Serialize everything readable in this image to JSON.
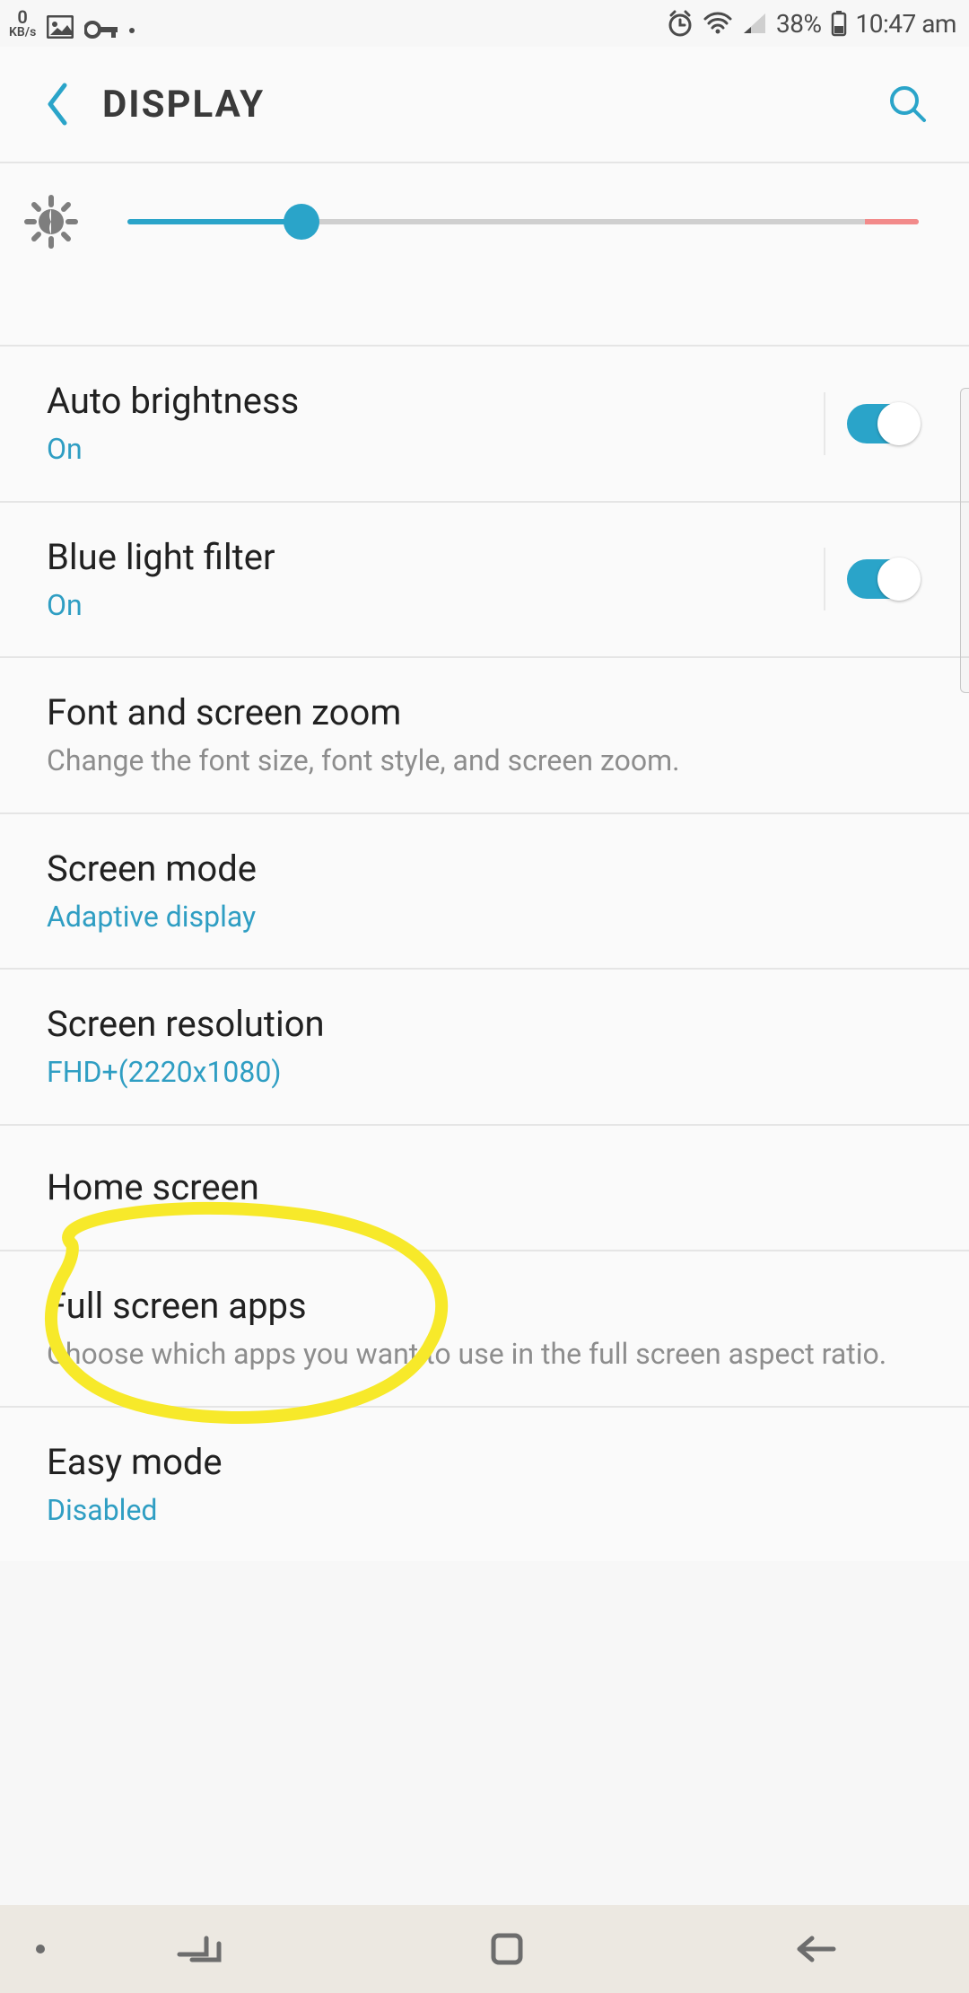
{
  "status": {
    "kbs_value": "0",
    "kbs_unit": "KB/s",
    "battery_pct": "38%",
    "time": "10:47 am"
  },
  "header": {
    "title": "DISPLAY"
  },
  "brightness": {
    "percent": 22
  },
  "rows": {
    "auto_brightness": {
      "title": "Auto brightness",
      "status": "On"
    },
    "blue_light": {
      "title": "Blue light filter",
      "status": "On"
    },
    "font_zoom": {
      "title": "Font and screen zoom",
      "sub": "Change the font size, font style, and screen zoom."
    },
    "screen_mode": {
      "title": "Screen mode",
      "sub": "Adaptive display"
    },
    "screen_res": {
      "title": "Screen resolution",
      "sub": "FHD+(2220x1080)"
    },
    "home_screen": {
      "title": "Home screen"
    },
    "full_screen": {
      "title": "Full screen apps",
      "sub": "Choose which apps you want to use in the full screen aspect ratio."
    },
    "easy_mode": {
      "title": "Easy mode",
      "sub": "Disabled"
    }
  }
}
